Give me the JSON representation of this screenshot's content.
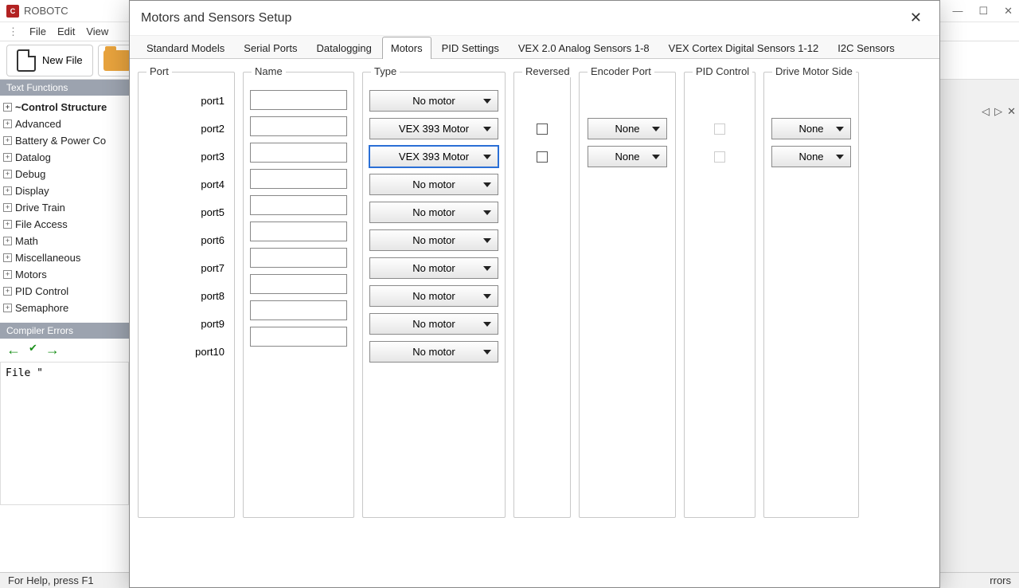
{
  "app": {
    "title": "ROBOTC",
    "menubar": [
      "File",
      "Edit",
      "View"
    ],
    "new_file_label": "New File",
    "statusbar_left": "For Help, press F1",
    "statusbar_right": "rrors"
  },
  "side_panel": {
    "title": "Text Functions",
    "items": [
      {
        "label": "~Control Structure",
        "bold": true
      },
      {
        "label": "Advanced"
      },
      {
        "label": "Battery & Power Co"
      },
      {
        "label": "Datalog"
      },
      {
        "label": "Debug"
      },
      {
        "label": "Display"
      },
      {
        "label": "Drive Train"
      },
      {
        "label": "File Access"
      },
      {
        "label": "Math"
      },
      {
        "label": "Miscellaneous"
      },
      {
        "label": "Motors"
      },
      {
        "label": "PID Control"
      },
      {
        "label": "Semaphore"
      }
    ]
  },
  "compiler_panel": {
    "title": "Compiler Errors",
    "log_text": "File \""
  },
  "dialog": {
    "title": "Motors and Sensors Setup",
    "tabs": [
      "Standard Models",
      "Serial Ports",
      "Datalogging",
      "Motors",
      "PID Settings",
      "VEX 2.0 Analog Sensors 1-8",
      "VEX Cortex Digital Sensors 1-12",
      "I2C Sensors"
    ],
    "active_tab_index": 3,
    "columns": {
      "port": "Port",
      "name": "Name",
      "type": "Type",
      "reversed": "Reversed",
      "encoder": "Encoder Port",
      "pid": "PID Control",
      "drive": "Drive Motor Side"
    },
    "ports": [
      "port1",
      "port2",
      "port3",
      "port4",
      "port5",
      "port6",
      "port7",
      "port8",
      "port9",
      "port10"
    ],
    "types": [
      "No motor",
      "VEX 393 Motor",
      "VEX 393 Motor",
      "No motor",
      "No motor",
      "No motor",
      "No motor",
      "No motor",
      "No motor",
      "No motor"
    ],
    "focused_type_row": 2,
    "reversed_rows": [
      1,
      2
    ],
    "encoder_rows": {
      "1": "None",
      "2": "None"
    },
    "pid_rows": [
      1,
      2
    ],
    "drive_rows": {
      "1": "None",
      "2": "None"
    }
  },
  "editor_nav": {
    "close_glyph": "✕"
  }
}
